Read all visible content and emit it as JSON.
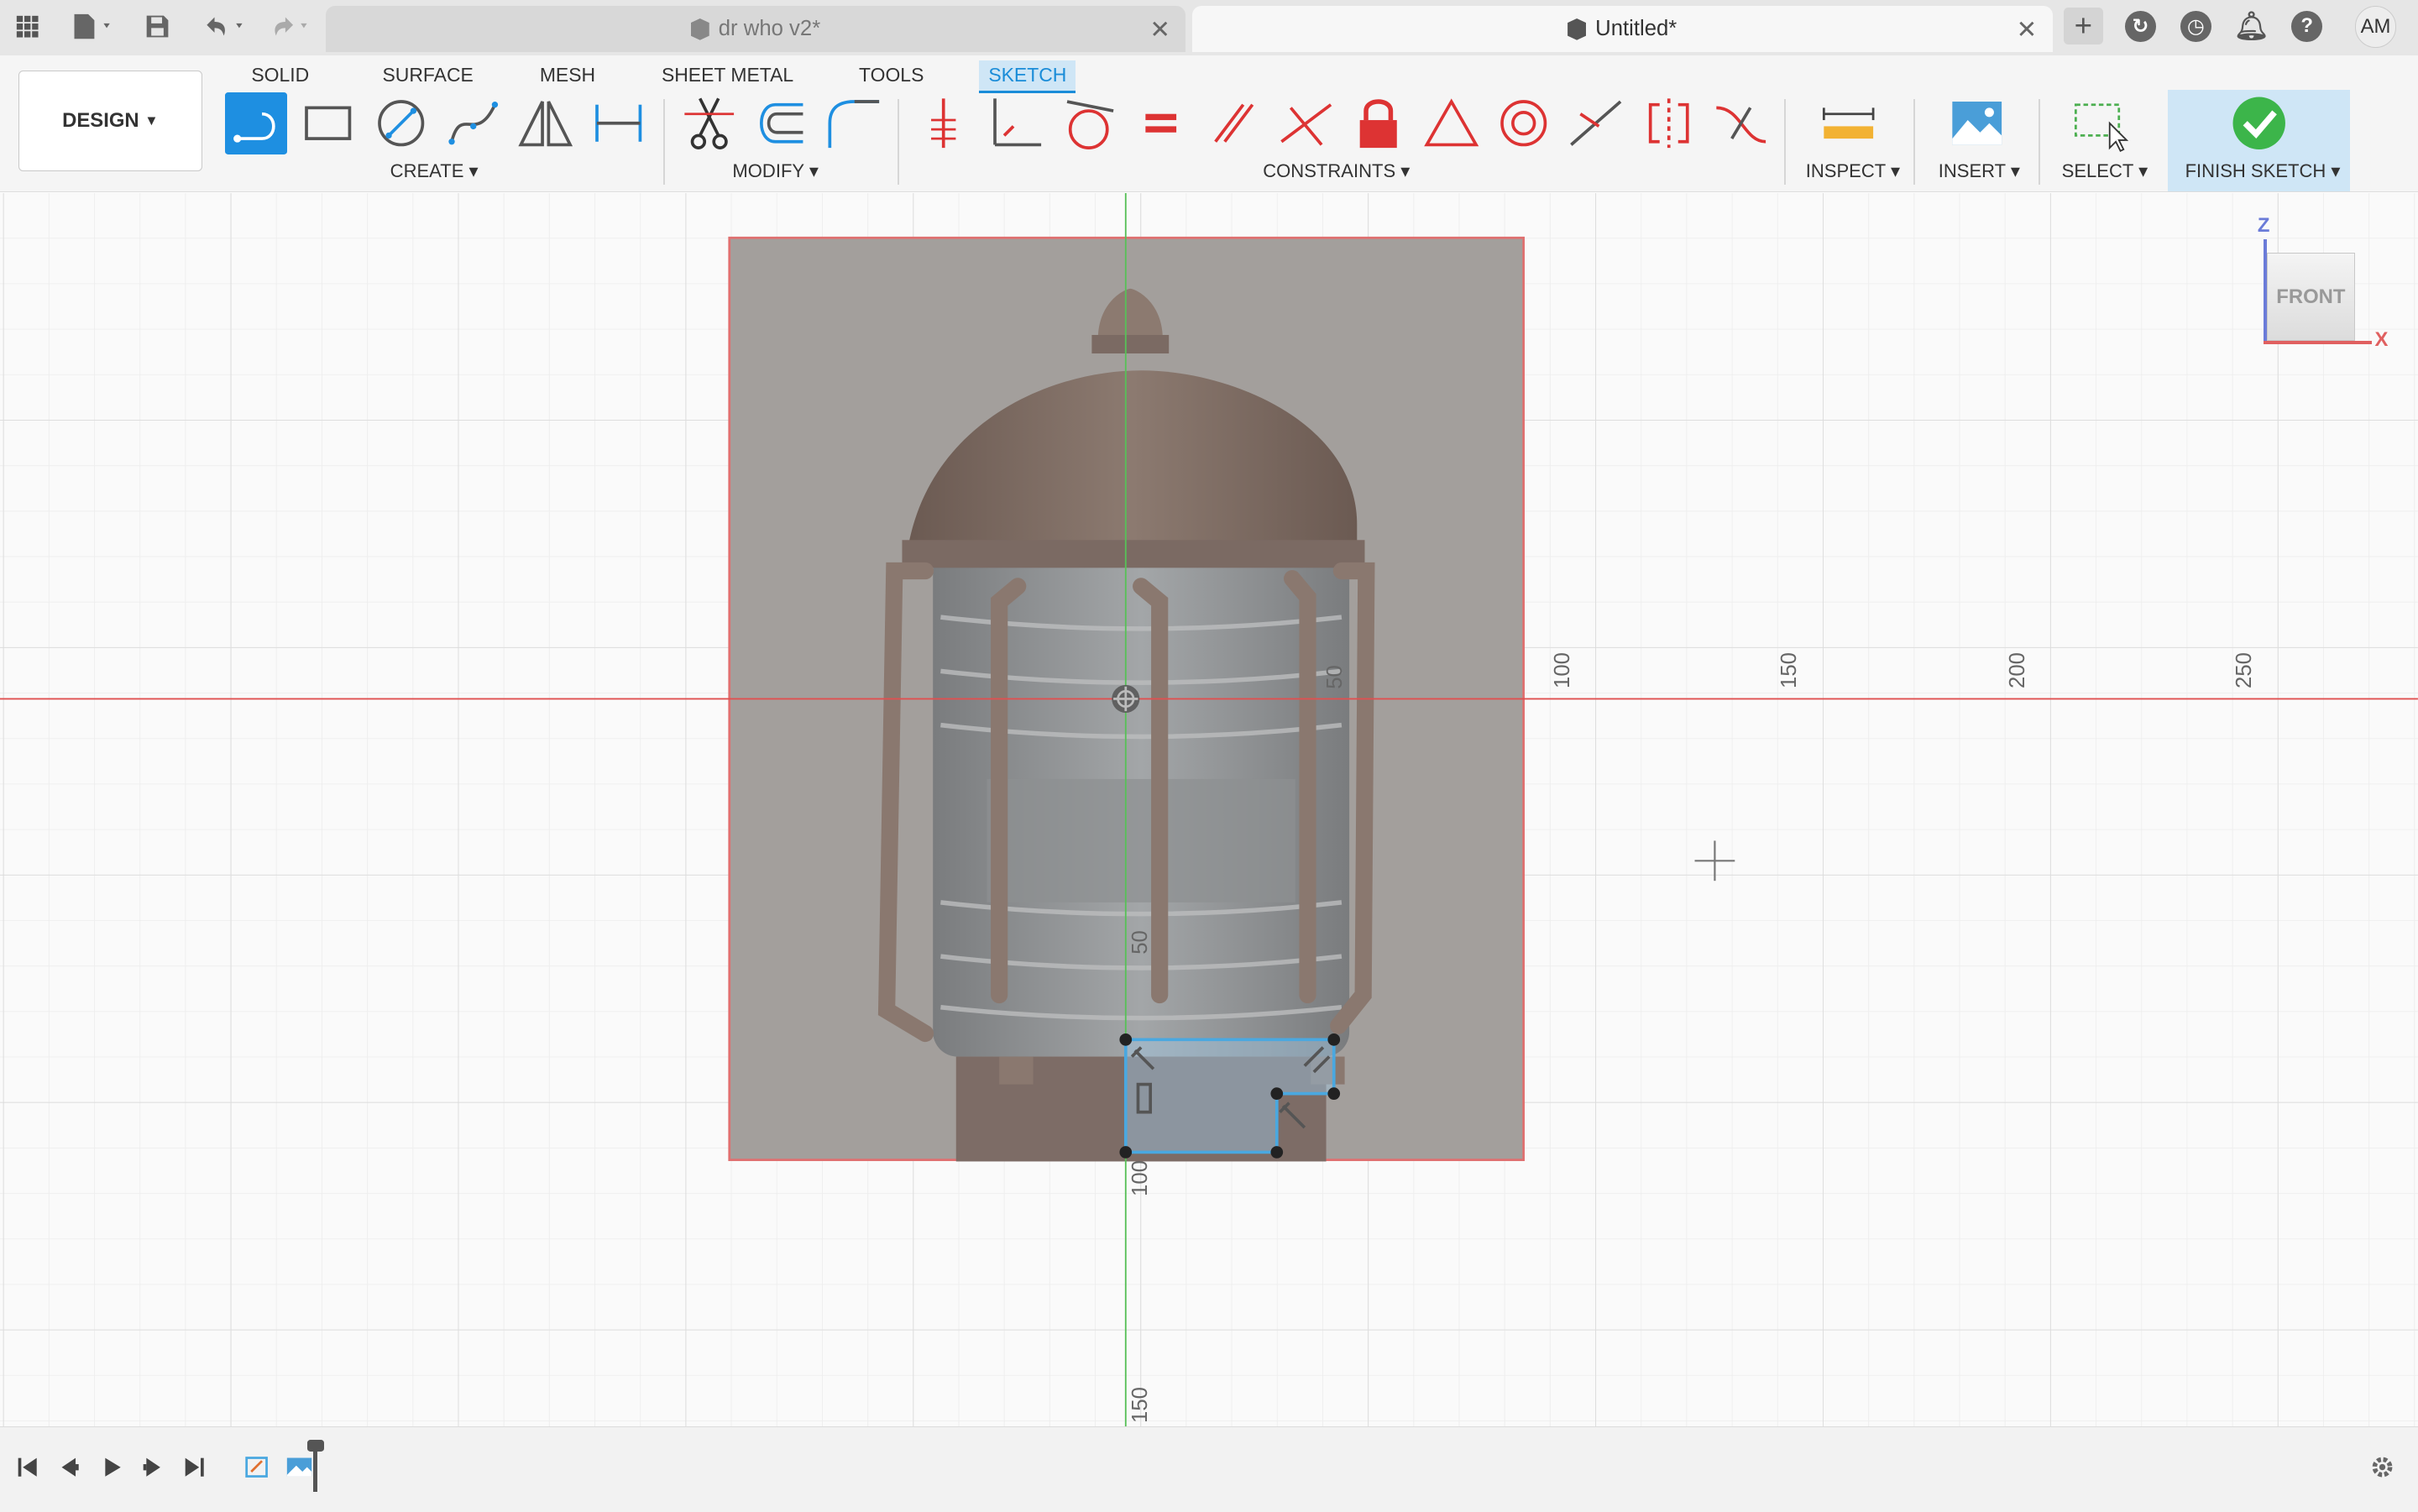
{
  "titlebar": {
    "tabs": [
      {
        "label": "dr who v2*"
      },
      {
        "label": "Untitled*"
      }
    ],
    "user_initials": "AM"
  },
  "ribbon": {
    "workspace": "DESIGN",
    "tabs": [
      "SOLID",
      "SURFACE",
      "MESH",
      "SHEET METAL",
      "TOOLS",
      "SKETCH"
    ],
    "active_tab": "SKETCH",
    "groups": {
      "create": "CREATE",
      "modify": "MODIFY",
      "constraints": "CONSTRAINTS",
      "inspect": "INSPECT",
      "insert": "INSERT",
      "select": "SELECT",
      "finish": "FINISH SKETCH"
    },
    "accent": "#1e8fe1"
  },
  "viewcube": {
    "face": "FRONT",
    "z_label": "Z",
    "x_label": "X"
  },
  "canvas": {
    "x_ticks": [
      "50",
      "100",
      "150",
      "200",
      "250"
    ],
    "y_ticks": [
      "50",
      "100",
      "150"
    ],
    "origin_axis_colors": {
      "x": "#e05050",
      "z": "#50c050"
    },
    "canvas_image": "lantern reference image",
    "sketch_color": "#4aa8e0"
  }
}
